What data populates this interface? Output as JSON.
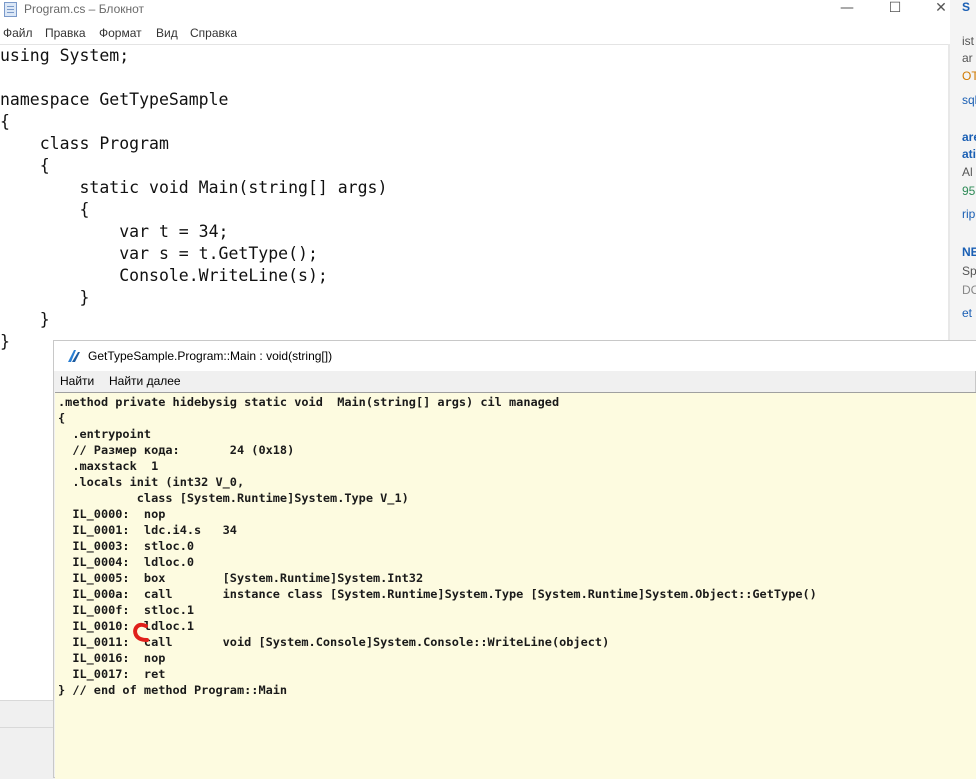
{
  "notepad": {
    "title": "Program.cs – Блокнот",
    "window_controls": {
      "minimize": "—",
      "maximize": "☐",
      "close": "✕"
    },
    "menu": [
      "Файл",
      "Правка",
      "Формат",
      "Вид",
      "Справка"
    ],
    "code": "using System;\n\nnamespace GetTypeSample\n{\n    class Program\n    {\n        static void Main(string[] args)\n        {\n            var t = 34;\n            var s = t.GetType();\n            Console.WriteLine(s);\n        }\n    }\n}"
  },
  "ildasm": {
    "title": "GetTypeSample.Program::Main : void(string[])",
    "menu": [
      "Найти",
      "Найти далее"
    ],
    "code": ".method private hidebysig static void  Main(string[] args) cil managed\n{\n  .entrypoint\n  // Размер кода:       24 (0x18)\n  .maxstack  1\n  .locals init (int32 V_0,\n           class [System.Runtime]System.Type V_1)\n  IL_0000:  nop\n  IL_0001:  ldc.i4.s   34\n  IL_0003:  stloc.0\n  IL_0004:  ldloc.0\n  IL_0005:  box        [System.Runtime]System.Int32\n  IL_000a:  call       instance class [System.Runtime]System.Type [System.Runtime]System.Object::GetType()\n  IL_000f:  stloc.1\n  IL_0010:  ldloc.1\n  IL_0011:  call       void [System.Console]System.Console::WriteLine(object)\n  IL_0016:  nop\n  IL_0017:  ret\n} // end of method Program::Main"
  },
  "background_window": {
    "fragments": [
      "S",
      "ist",
      "ar",
      "OT",
      "sql",
      "are",
      "ati",
      "Al",
      "95",
      "rip",
      "NE",
      "Sp",
      "DC",
      "et"
    ]
  },
  "colors": {
    "il_background": "#fdfbe0",
    "annotation_mark": "#e0201b",
    "background_window_link": "#1a5fb4"
  },
  "icons": {
    "notepad_app": "notepad-app-icon",
    "ildasm_app": "ildasm-app-icon",
    "annotation": "red-bracket-mark"
  }
}
